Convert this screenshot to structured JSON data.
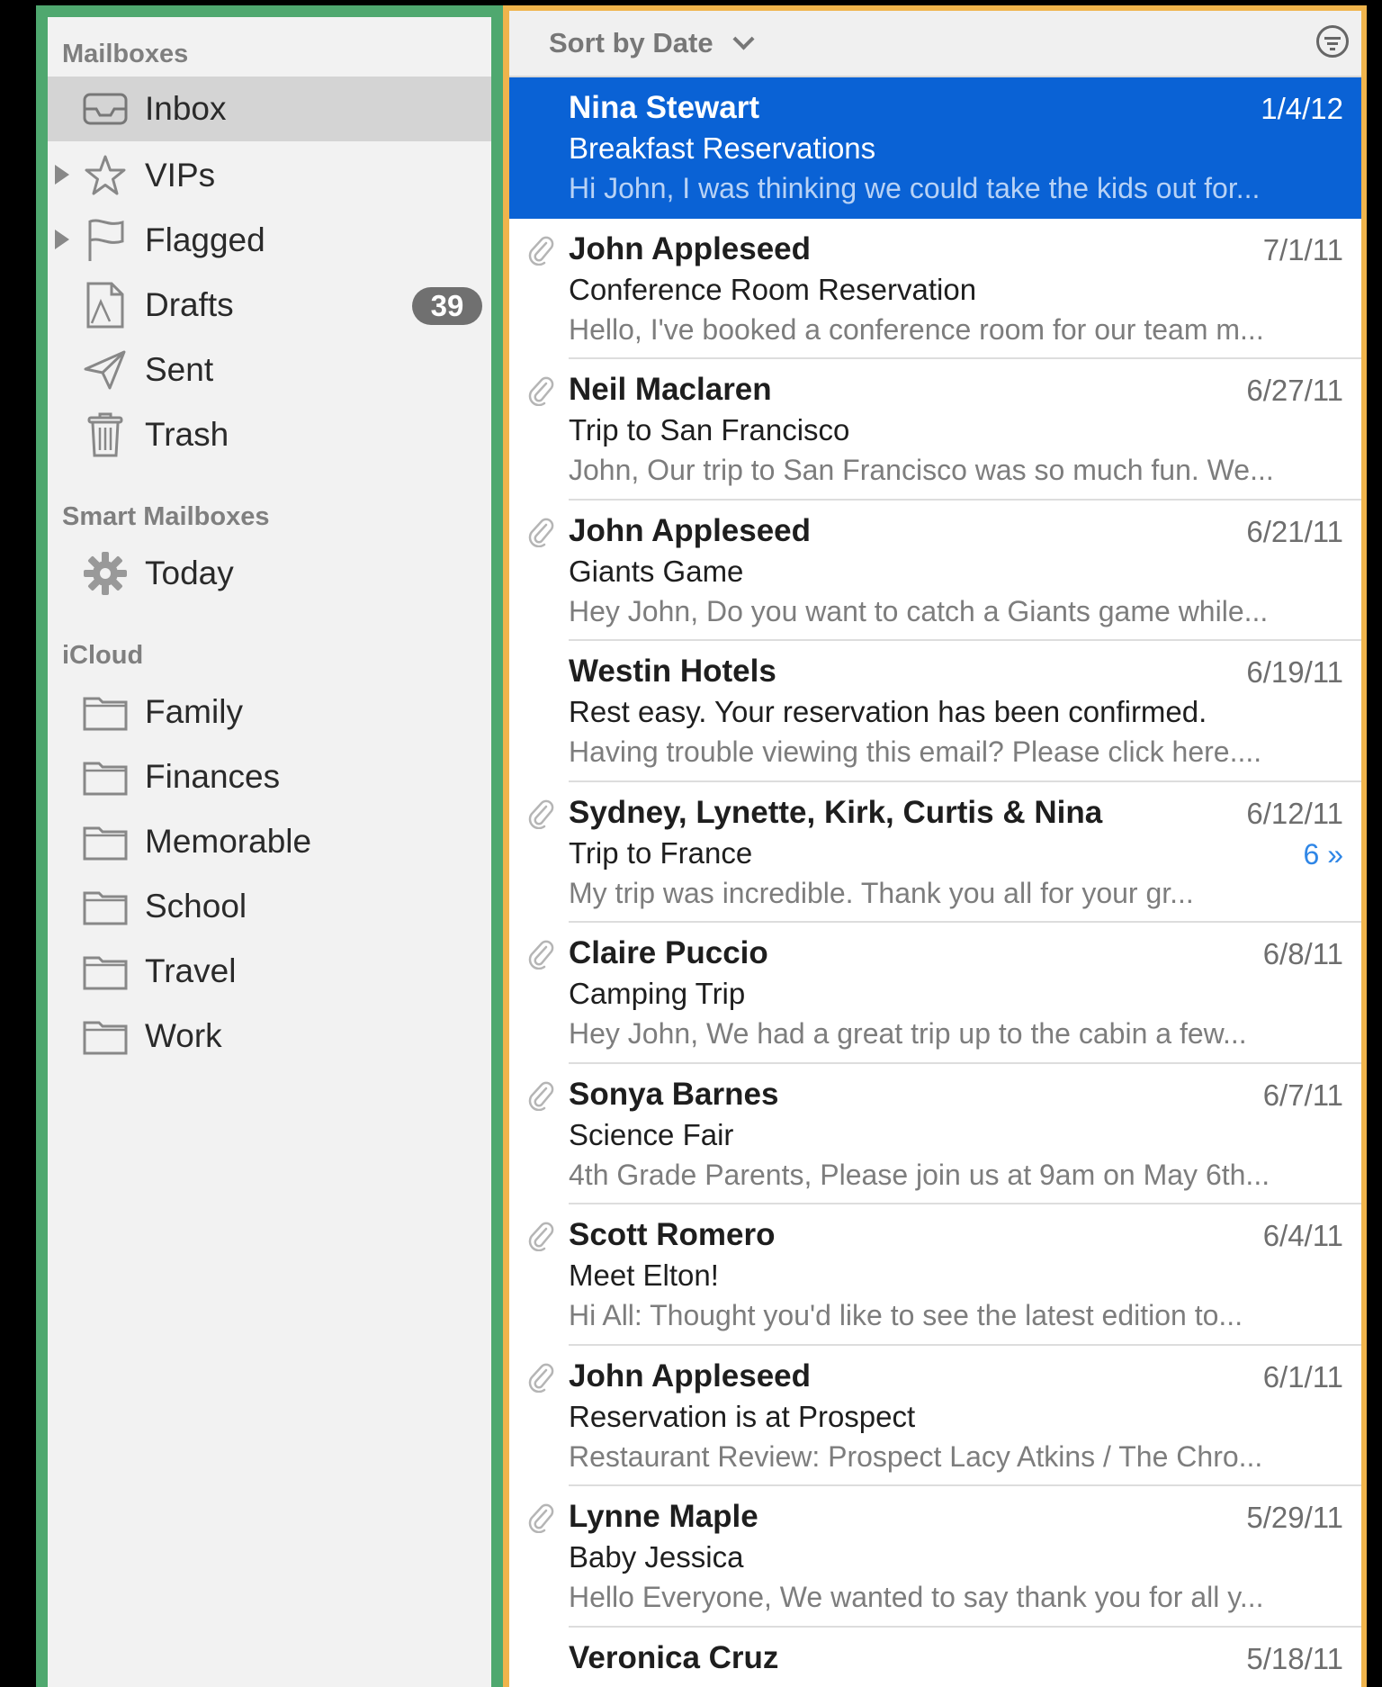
{
  "sidebar": {
    "mailboxes_header": "Mailboxes",
    "mailboxes": [
      {
        "label": "Inbox",
        "icon": "inbox-icon"
      },
      {
        "label": "VIPs",
        "icon": "star-icon"
      },
      {
        "label": "Flagged",
        "icon": "flag-icon"
      },
      {
        "label": "Drafts",
        "icon": "drafts-icon",
        "badge": "39"
      },
      {
        "label": "Sent",
        "icon": "paper-plane-icon"
      },
      {
        "label": "Trash",
        "icon": "trash-icon"
      }
    ],
    "smart_header": "Smart Mailboxes",
    "smart": [
      {
        "label": "Today",
        "icon": "gear-icon"
      }
    ],
    "icloud_header": "iCloud",
    "icloud": [
      {
        "label": "Family",
        "icon": "folder-icon"
      },
      {
        "label": "Finances",
        "icon": "folder-icon"
      },
      {
        "label": "Memorable",
        "icon": "folder-icon"
      },
      {
        "label": "School",
        "icon": "folder-icon"
      },
      {
        "label": "Travel",
        "icon": "folder-icon"
      },
      {
        "label": "Work",
        "icon": "folder-icon"
      }
    ]
  },
  "list": {
    "sort_label": "Sort by Date",
    "messages": [
      {
        "sender": "Nina Stewart",
        "date": "1/4/12",
        "subject": "Breakfast Reservations",
        "preview": "Hi John, I was thinking we could take the kids out for...",
        "attachment": false
      },
      {
        "sender": "John Appleseed",
        "date": "7/1/11",
        "subject": "Conference Room Reservation",
        "preview": "Hello, I've booked a conference room for our team m...",
        "attachment": true
      },
      {
        "sender": "Neil Maclaren",
        "date": "6/27/11",
        "subject": "Trip to San Francisco",
        "preview": "John, Our trip to San Francisco was so much fun. We...",
        "attachment": true
      },
      {
        "sender": "John Appleseed",
        "date": "6/21/11",
        "subject": "Giants Game",
        "preview": "Hey John, Do you want to catch a Giants game while...",
        "attachment": true
      },
      {
        "sender": "Westin Hotels",
        "date": "6/19/11",
        "subject": "Rest easy. Your reservation has been confirmed.",
        "preview": "Having trouble viewing this email? Please click here....",
        "attachment": false
      },
      {
        "sender": "Sydney, Lynette, Kirk, Curtis & Nina",
        "date": "6/12/11",
        "subject": "Trip to France",
        "preview": "My trip was incredible. Thank you all for your gr...",
        "attachment": true,
        "thread_count": "6 »"
      },
      {
        "sender": "Claire Puccio",
        "date": "6/8/11",
        "subject": "Camping Trip",
        "preview": "Hey John, We had a great trip up to the cabin a few...",
        "attachment": true
      },
      {
        "sender": "Sonya Barnes",
        "date": "6/7/11",
        "subject": "Science Fair",
        "preview": "4th Grade Parents, Please join us at 9am on May 6th...",
        "attachment": true
      },
      {
        "sender": "Scott Romero",
        "date": "6/4/11",
        "subject": "Meet Elton!",
        "preview": "Hi All: Thought you'd like to see the latest edition to...",
        "attachment": true
      },
      {
        "sender": "John Appleseed",
        "date": "6/1/11",
        "subject": "Reservation is at Prospect",
        "preview": "Restaurant Review: Prospect Lacy Atkins / The Chro...",
        "attachment": true
      },
      {
        "sender": "Lynne Maple",
        "date": "5/29/11",
        "subject": "Baby Jessica",
        "preview": "Hello Everyone, We wanted to say thank you for all y...",
        "attachment": true
      },
      {
        "sender": "Veronica Cruz",
        "date": "5/18/11",
        "subject": "",
        "preview": "",
        "attachment": false
      }
    ]
  },
  "colors": {
    "sidebar_border": "#4fa86f",
    "list_border": "#f0b44c",
    "selection": "#0a62d5",
    "thread_accent": "#2f86e6"
  }
}
